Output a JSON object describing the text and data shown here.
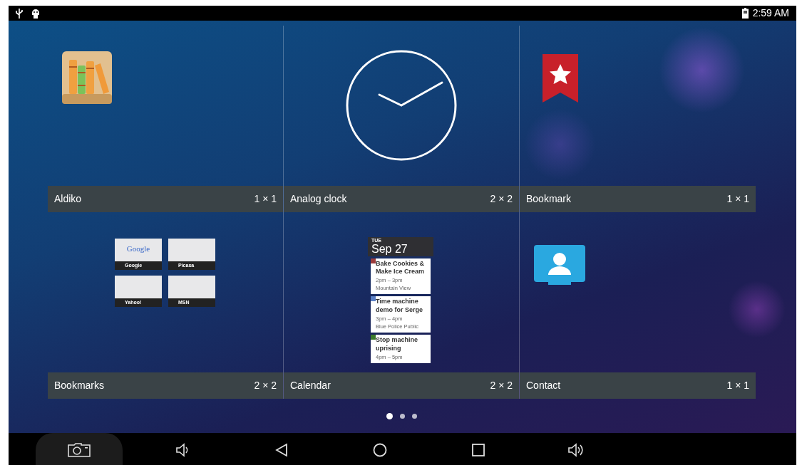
{
  "status_bar": {
    "time": "2:59 AM"
  },
  "widgets": [
    {
      "kind": "books",
      "name": "Aldiko",
      "size": "1 × 1"
    },
    {
      "kind": "clock",
      "name": "Analog clock",
      "size": "2 × 2"
    },
    {
      "kind": "bookmark",
      "name": "Bookmark",
      "size": "1 × 1"
    },
    {
      "kind": "bookmarks",
      "name": "Bookmarks",
      "size": "2 × 2",
      "thumbnails": [
        {
          "label": "Google",
          "page_text": "Google"
        },
        {
          "label": "Picasa"
        },
        {
          "label": "Yahoo!"
        },
        {
          "label": "MSN"
        }
      ]
    },
    {
      "kind": "calendar",
      "name": "Calendar",
      "size": "2 × 2",
      "day": "TUE",
      "date": "Sep 27",
      "events": [
        {
          "title": "Bake Cookies & Make Ice Cream",
          "time": "2pm – 3pm",
          "place": "Mountain View",
          "color": "#9c3b3b"
        },
        {
          "title": "Time machine demo for Serge",
          "time": "3pm – 4pm",
          "place": "Blue Police Public",
          "color": "#5b7fc4"
        },
        {
          "title": "Stop machine uprising",
          "time": "4pm – 5pm",
          "color": "#3c7a2c"
        }
      ]
    },
    {
      "kind": "contact",
      "name": "Contact",
      "size": "1 × 1"
    }
  ],
  "page_dots": [
    {
      "selected": true
    },
    {
      "selected": false
    },
    {
      "selected": false
    }
  ]
}
